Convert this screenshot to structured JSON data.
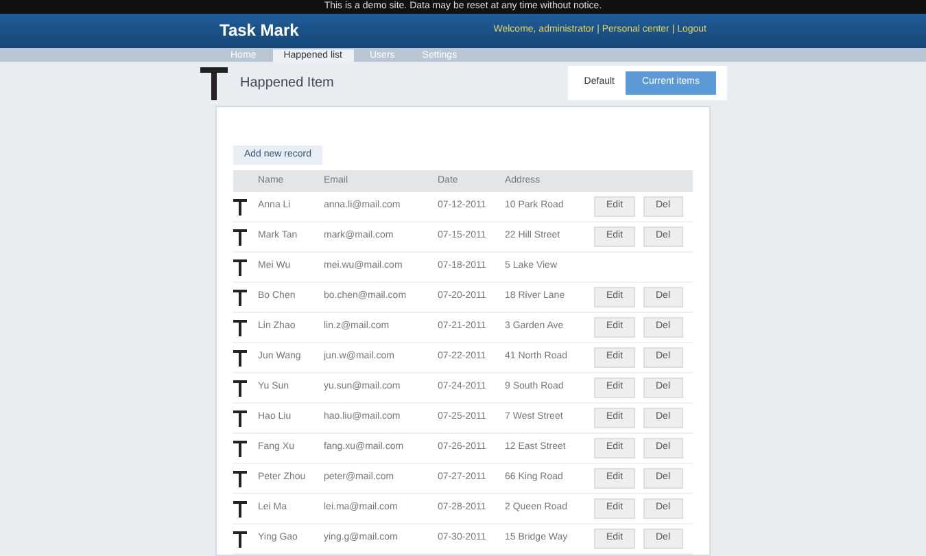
{
  "notice": "This is a demo site. Data may be reset at any time without notice.",
  "header": {
    "logo": "Task Mark",
    "account": "Welcome, administrator | Personal center | Logout"
  },
  "nav": [
    {
      "label": "Home",
      "selected": false
    },
    {
      "label": "Happened list",
      "selected": true
    },
    {
      "label": "Users",
      "selected": false
    },
    {
      "label": "Settings",
      "selected": false
    }
  ],
  "page": {
    "title": "Happened Item",
    "steps": [
      {
        "label": "Default",
        "selected": false
      },
      {
        "label": "Current items",
        "selected": true
      }
    ]
  },
  "toolbar": {
    "add": "Add new record"
  },
  "table": {
    "columns": [
      "Name",
      "Email",
      "Date",
      "Address"
    ],
    "rows": [
      {
        "name": "Anna Li",
        "email": "anna.li@mail.com",
        "date": "07-12-2011",
        "address": "10 Park Road",
        "actions": [
          "Edit",
          "Del"
        ]
      },
      {
        "name": "Mark Tan",
        "email": "mark@mail.com",
        "date": "07-15-2011",
        "address": "22 Hill Street",
        "actions": [
          "Edit",
          "Del"
        ]
      },
      {
        "name": "Mei Wu",
        "email": "mei.wu@mail.com",
        "date": "07-18-2011",
        "address": "5 Lake View",
        "actions": []
      },
      {
        "name": "Bo Chen",
        "email": "bo.chen@mail.com",
        "date": "07-20-2011",
        "address": "18 River Lane",
        "actions": [
          "Edit",
          "Del"
        ]
      },
      {
        "name": "Lin Zhao",
        "email": "lin.z@mail.com",
        "date": "07-21-2011",
        "address": "3 Garden Ave",
        "actions": [
          "Edit",
          "Del"
        ]
      },
      {
        "name": "Jun Wang",
        "email": "jun.w@mail.com",
        "date": "07-22-2011",
        "address": "41 North Road",
        "actions": [
          "Edit",
          "Del"
        ]
      },
      {
        "name": "Yu Sun",
        "email": "yu.sun@mail.com",
        "date": "07-24-2011",
        "address": "9 South Road",
        "actions": [
          "Edit",
          "Del"
        ]
      },
      {
        "name": "Hao Liu",
        "email": "hao.liu@mail.com",
        "date": "07-25-2011",
        "address": "7 West Street",
        "actions": [
          "Edit",
          "Del"
        ]
      },
      {
        "name": "Fang Xu",
        "email": "fang.xu@mail.com",
        "date": "07-26-2011",
        "address": "12 East Street",
        "actions": [
          "Edit",
          "Del"
        ]
      },
      {
        "name": "Peter Zhou",
        "email": "peter@mail.com",
        "date": "07-27-2011",
        "address": "66 King Road",
        "actions": [
          "Edit",
          "Del"
        ]
      },
      {
        "name": "Lei Ma",
        "email": "lei.ma@mail.com",
        "date": "07-28-2011",
        "address": "2 Queen Road",
        "actions": [
          "Edit",
          "Del"
        ]
      },
      {
        "name": "Ying Gao",
        "email": "ying.g@mail.com",
        "date": "07-30-2011",
        "address": "15 Bridge Way",
        "actions": [
          "Edit",
          "Del"
        ]
      }
    ]
  }
}
